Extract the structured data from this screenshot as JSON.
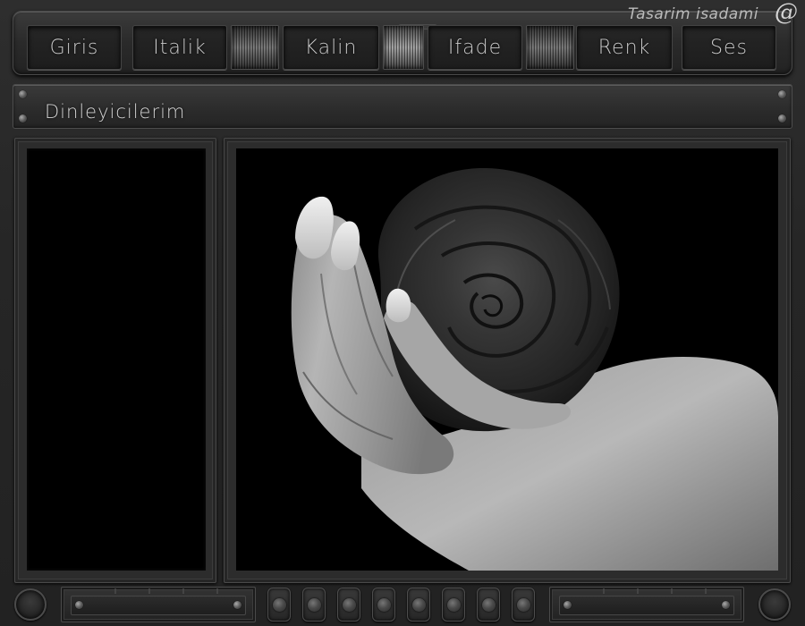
{
  "brand": {
    "text": "Tasarim isadami",
    "symbol": "@"
  },
  "nav": [
    {
      "label": "Giris"
    },
    {
      "label": "Italik"
    },
    {
      "label": "Kalin"
    },
    {
      "label": "Ifade"
    },
    {
      "label": "Renk"
    },
    {
      "label": "Ses"
    }
  ],
  "header": {
    "title": "Dinleyicilerim"
  },
  "colors": {
    "background": "#1d1d1d",
    "panel": "#2c2c2c",
    "text": "#c9c9c9"
  },
  "icons": [
    "rivet-icon",
    "grille-icon",
    "knob-icon",
    "dot-button-icon"
  ]
}
